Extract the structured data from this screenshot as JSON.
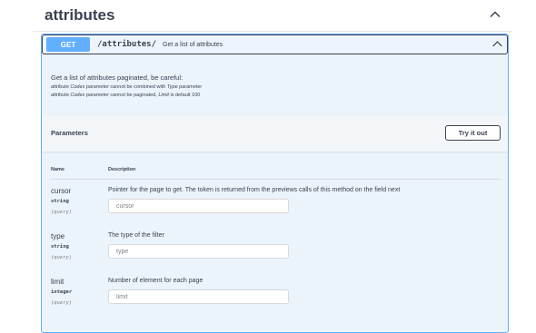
{
  "tag": {
    "title": "attributes"
  },
  "operation": {
    "method": "GET",
    "path": "/attributes/",
    "summary": "Get a list of attributes",
    "description": "Get a list of attributes paginated, be careful:",
    "notes": [
      {
        "pre": "attribute ",
        "em1": "Codes",
        "mid": " parameter cannot be combined with ",
        "em2": "Type",
        "post": " parameter"
      },
      {
        "pre": "attribute ",
        "em1": "Codes",
        "mid": " parameter cannot be paginated, ",
        "em2": "Limit",
        "post": " is default 100"
      }
    ]
  },
  "parameters_section": {
    "title": "Parameters",
    "try_button": "Try it out",
    "col_name": "Name",
    "col_description": "Description"
  },
  "params": [
    {
      "name": "cursor",
      "type": "string",
      "in": "(query)",
      "description": "Pointer for the page to get. The token is returned from the previews calls of this method on the field next",
      "placeholder": "cursor"
    },
    {
      "name": "type",
      "type": "string",
      "in": "(query)",
      "description": "The type of the filter",
      "placeholder": "type"
    },
    {
      "name": "limit",
      "type": "integer",
      "in": "(query)",
      "description": "Number of element for each page",
      "placeholder": "limit"
    }
  ],
  "colors": {
    "get": "#61affe",
    "text": "#3b4151",
    "block_bg": "#ebf3fb"
  },
  "icons": {
    "tag_toggle": "chevron-up-icon",
    "op_toggle": "chevron-up-icon"
  }
}
